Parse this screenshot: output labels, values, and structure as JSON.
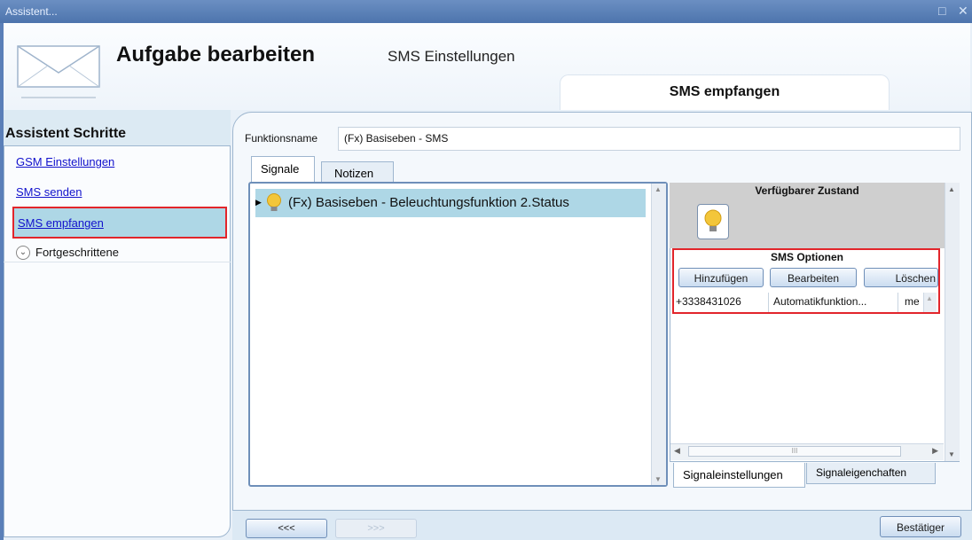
{
  "window": {
    "title": "Assistent..."
  },
  "header": {
    "title": "Aufgabe bearbeiten",
    "subtitle": "SMS Einstellungen",
    "active_tab": "SMS empfangen",
    "icon": "envelope-icon"
  },
  "sidebar": {
    "heading": "Assistent Schritte",
    "items": [
      {
        "label": "GSM Einstellungen"
      },
      {
        "label": "SMS senden"
      },
      {
        "label": "SMS empfangen"
      }
    ],
    "advanced_label": "Fortgeschrittene"
  },
  "form": {
    "name_label": "Funktionsname",
    "name_value": "(Fx) Basiseben - SMS"
  },
  "tabs": [
    {
      "label": "Signale"
    },
    {
      "label": "Notizen"
    }
  ],
  "signal_list": [
    {
      "label": "(Fx) Basiseben - Beleuchtungsfunktion 2.Status",
      "icon": "lightbulb-icon"
    }
  ],
  "state_panel": {
    "heading": "Verfügbarer Zustand",
    "state_icon": "lightbulb-icon",
    "sms_heading": "SMS Optionen",
    "buttons": {
      "add": "Hinzufügen",
      "edit": "Bearbeiten",
      "delete": "Löschen"
    },
    "row": {
      "phone": "+3338431026",
      "function": "Automatikfunktion...",
      "extra": "me"
    },
    "scroll_thumb": "III"
  },
  "bottom_tabs": [
    {
      "label": "Signaleinstellungen"
    },
    {
      "label": "Signaleigenchaften"
    }
  ],
  "nav": {
    "back": "<<<",
    "forward": ">>>",
    "confirm": "Bestätiger"
  },
  "colors": {
    "titlebar": "#5a7fb8",
    "highlight": "#e2252b",
    "selection": "#aed7e6"
  }
}
